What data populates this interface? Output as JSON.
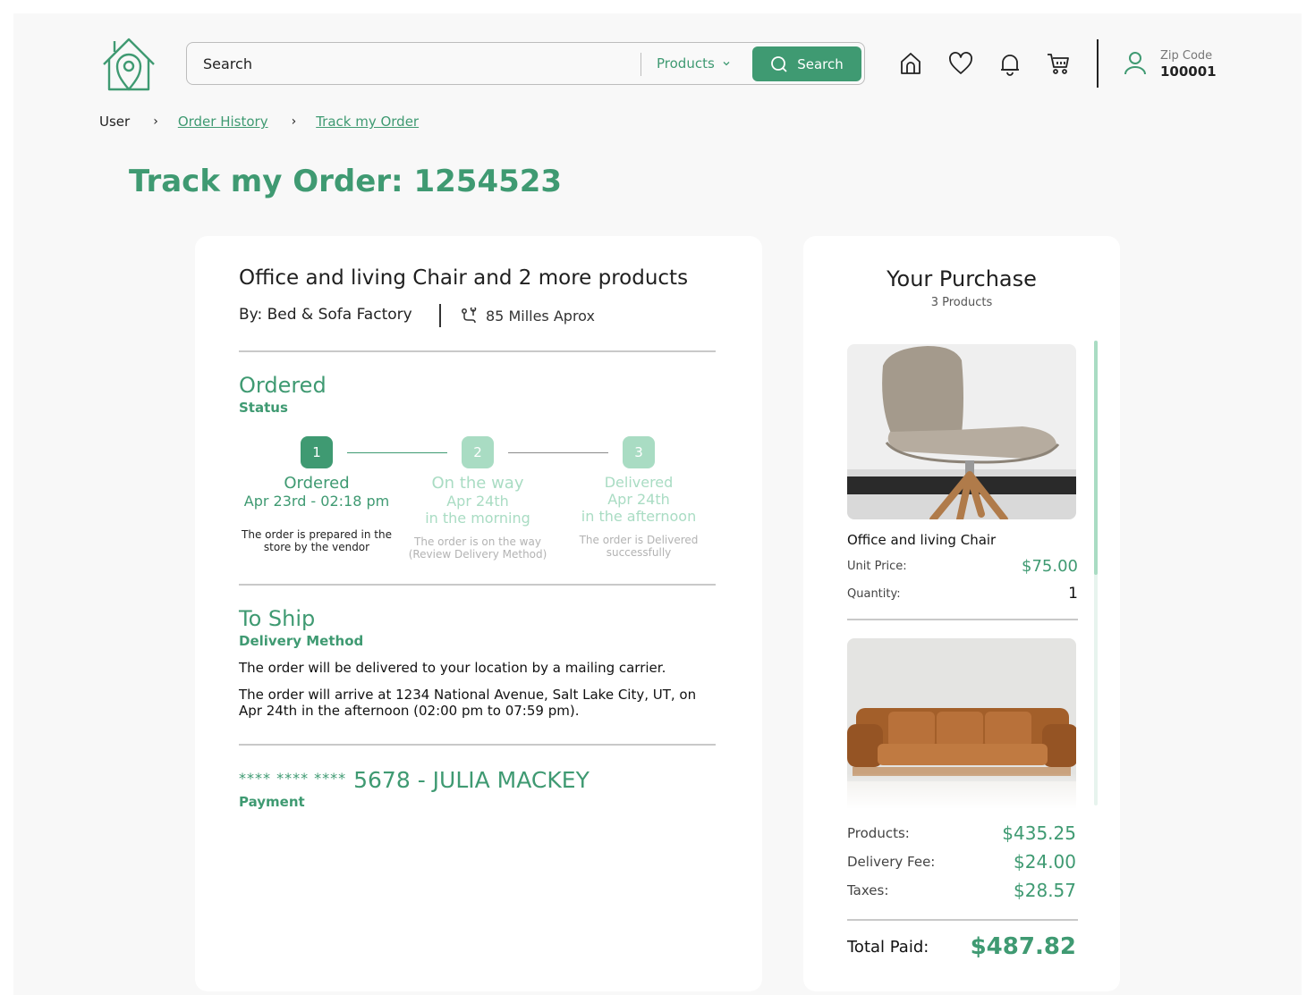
{
  "header": {
    "search_placeholder": "Search",
    "category": "Products",
    "search_button": "Search",
    "zip_label": "Zip Code",
    "zip_value": "100001"
  },
  "breadcrumb": [
    "User",
    "Order History",
    "Track my Order"
  ],
  "page_title": "Track my Order: 1254523",
  "order": {
    "title": "Office and living Chair and 2 more products",
    "vendor": "By: Bed & Sofa Factory",
    "distance": "85 Milles Aprox",
    "status_title": "Ordered",
    "status_label": "Status",
    "steps": [
      {
        "num": "1",
        "name": "Ordered",
        "date": "Apr 23rd - 02:18 pm",
        "date2": "",
        "desc": "The order is prepared in the store by the vendor"
      },
      {
        "num": "2",
        "name": "On the way",
        "date": "Apr 24th",
        "date2": "in the morning",
        "desc": "The order is on the way (Review Delivery Method)"
      },
      {
        "num": "3",
        "name": "Delivered",
        "date": "Apr 24th",
        "date2": "in the afternoon",
        "desc": "The order is Delivered successfully"
      }
    ],
    "ship_title": "To Ship",
    "ship_label": "Delivery Method",
    "ship_line1": "The order will be delivered to your location by a mailing carrier.",
    "ship_line2": "The order will arrive at 1234 National Avenue, Salt Lake City, UT, on Apr 24th in the afternoon (02:00 pm to 07:59 pm).",
    "card_stars": "**** **** ****",
    "card_name": "5678 - JULIA MACKEY",
    "payment_label": "Payment"
  },
  "purchase": {
    "title": "Your Purchase",
    "count": "3 Products",
    "items": [
      {
        "name": "Office and living Chair",
        "unit_label": "Unit Price:",
        "price": "$75.00",
        "qty_label": "Quantity:",
        "qty": "1"
      }
    ],
    "products_label": "Products:",
    "products_value": "$435.25",
    "delivery_label": "Delivery Fee:",
    "delivery_value": "$24.00",
    "taxes_label": "Taxes:",
    "taxes_value": "$28.57",
    "total_label": "Total Paid:",
    "total_value": "$487.82"
  },
  "colors": {
    "accent": "#3f9a72",
    "accent_light": "#a9dcc3",
    "background": "#f8f8f8"
  }
}
